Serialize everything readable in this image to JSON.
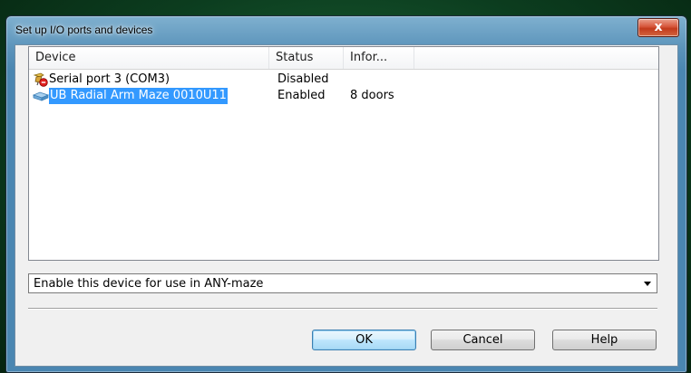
{
  "window": {
    "title": "Set up I/O ports and devices",
    "close_glyph": "x"
  },
  "list": {
    "columns": [
      "Device",
      "Status",
      "Infor..."
    ],
    "rows": [
      {
        "device": "Serial port 3 (COM3)",
        "status": "Disabled",
        "info": "",
        "icon": "serial-port-disabled-icon",
        "selected": false
      },
      {
        "device": "UB Radial Arm Maze 0010U11",
        "status": "Enabled",
        "info": "8 doors",
        "icon": "device-enabled-icon",
        "selected": true
      }
    ]
  },
  "dropdown": {
    "selected": "Enable this device for use in ANY-maze"
  },
  "buttons": {
    "ok": "OK",
    "cancel": "Cancel",
    "help": "Help"
  },
  "colors": {
    "selection": "#3399ff",
    "disabled_badge": "#e02020",
    "title_bar": "#5b93ba"
  }
}
